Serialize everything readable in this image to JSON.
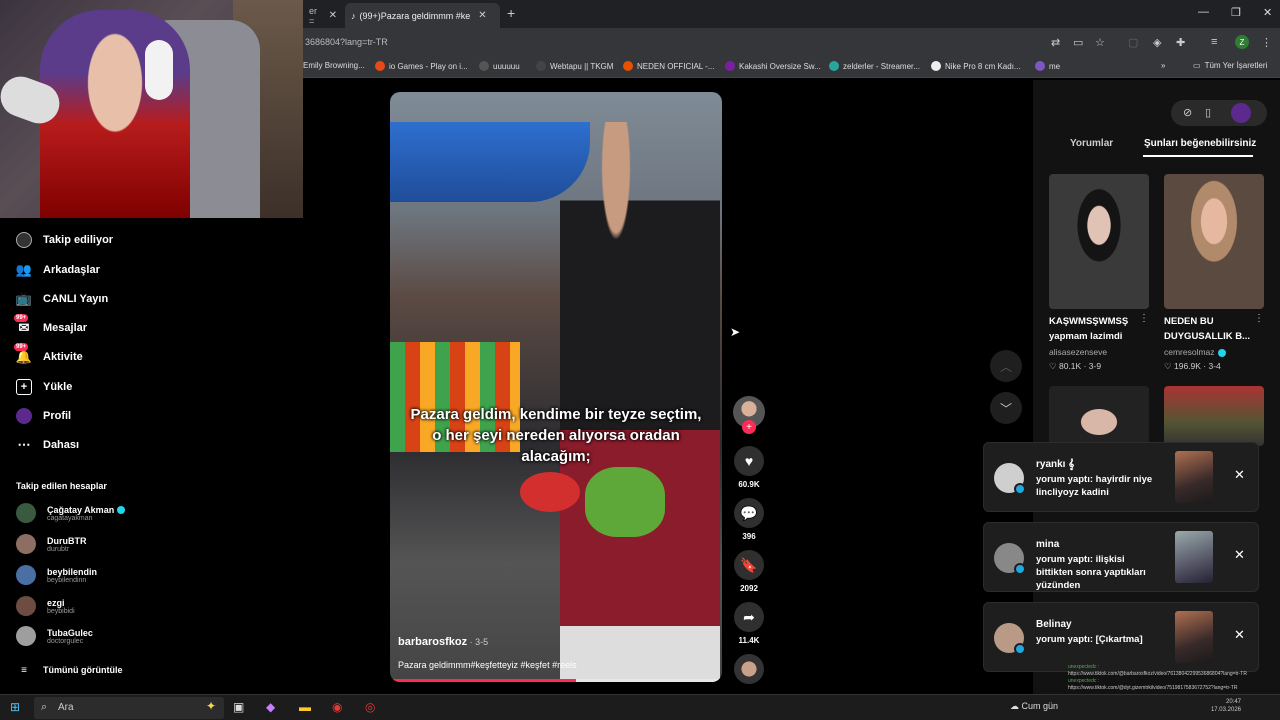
{
  "browser": {
    "tabs": [
      {
        "title": "er ="
      },
      {
        "title": "(99+)Pazara geldimmm #ke"
      }
    ],
    "url": "3686804?lang=tr-TR",
    "profile_initial": "Z",
    "bookmarks": [
      "Emily Browning...",
      "io Games - Play on i...",
      "uuuuuu",
      "Webtapu || TKGM",
      "NEDEN OFFICIAL -...",
      "Kakashi Oversize Sw...",
      "zelderler - Streamer...",
      "Nike Pro 8 cm Kadı...",
      "me"
    ],
    "all_bookmarks": "Tüm Yer İşaretleri",
    "colors": {
      "tiktok_red": "#fe2c55",
      "verified": "#20d5ec"
    }
  },
  "sidebar": {
    "nav": [
      {
        "label": "Takip ediliyor",
        "icon": "following-icon"
      },
      {
        "label": "Arkadaşlar",
        "icon": "friends-icon"
      },
      {
        "label": "CANLI Yayın",
        "icon": "live-icon"
      },
      {
        "label": "Mesajlar",
        "icon": "messages-icon",
        "badge": "99+"
      },
      {
        "label": "Aktivite",
        "icon": "activity-icon",
        "badge": "99+"
      },
      {
        "label": "Yükle",
        "icon": "upload-icon"
      },
      {
        "label": "Profil",
        "icon": "profile-icon"
      },
      {
        "label": "Dahası",
        "icon": "more-icon"
      }
    ],
    "following_header": "Takip edilen hesaplar",
    "accounts": [
      {
        "name": "Çağatay Akman",
        "username": "cagatayakman",
        "verified": true
      },
      {
        "name": "DuruBTR",
        "username": "durubtr"
      },
      {
        "name": "beybilendin",
        "username": "beybilendinn"
      },
      {
        "name": "ezgi",
        "username": "beybibidi"
      },
      {
        "name": "TubaGulec",
        "username": "doctorgulec"
      }
    ],
    "see_all": "Tümünü görüntüle"
  },
  "video": {
    "caption": "Pazara geldim, kendime bir teyze seçtim, o her şeyi nereden alıyorsa oradan alacağım;",
    "username": "barbarosfkoz",
    "date": " · 3-5",
    "description": "Pazara geldimmm#keşfetteyiz #keşfet #reels",
    "progress": 0.56,
    "likes": "60.9K",
    "comments": "396",
    "saves": "2092",
    "shares": "11.4K"
  },
  "right": {
    "tabs": [
      "Yorumlar",
      "Şunları beğenebilirsiniz"
    ],
    "videos": [
      {
        "title": "KAŞWMSŞWMSŞ yapmam lazimdi",
        "user": "alisasezenseve",
        "likes": "80.1K",
        "date": "3-9"
      },
      {
        "title": "NEDEN BU DUYGUSALLIK B...",
        "user": "cemresolmaz",
        "likes": "196.9K",
        "date": "3-4"
      }
    ]
  },
  "notifications": [
    {
      "name": "ryankı 𝄞",
      "text": "yorum yaptı: hayirdir niye lincliyoyz kadini"
    },
    {
      "name": "mina",
      "text": "yorum yaptı: ilişkisi bittikten sonra yaptıkları yüzünden"
    },
    {
      "name": "Belinay",
      "text": "yorum yaptı: [Çıkartma]"
    }
  ],
  "chat": [
    "unexpectedc :",
    "https://www.tiktok.com/@barbarosfkoz/video/7613804229953686804?lang=tr-TR",
    "unexpectedc :",
    "https://www.tiktok.com/@dyt.gizemtrkilvideo/7519817583672752?lang=tr-TR"
  ],
  "taskbar": {
    "search_placeholder": "Ara",
    "weather": "Cum gün",
    "time": "20:47",
    "date": "17.03.2026"
  }
}
